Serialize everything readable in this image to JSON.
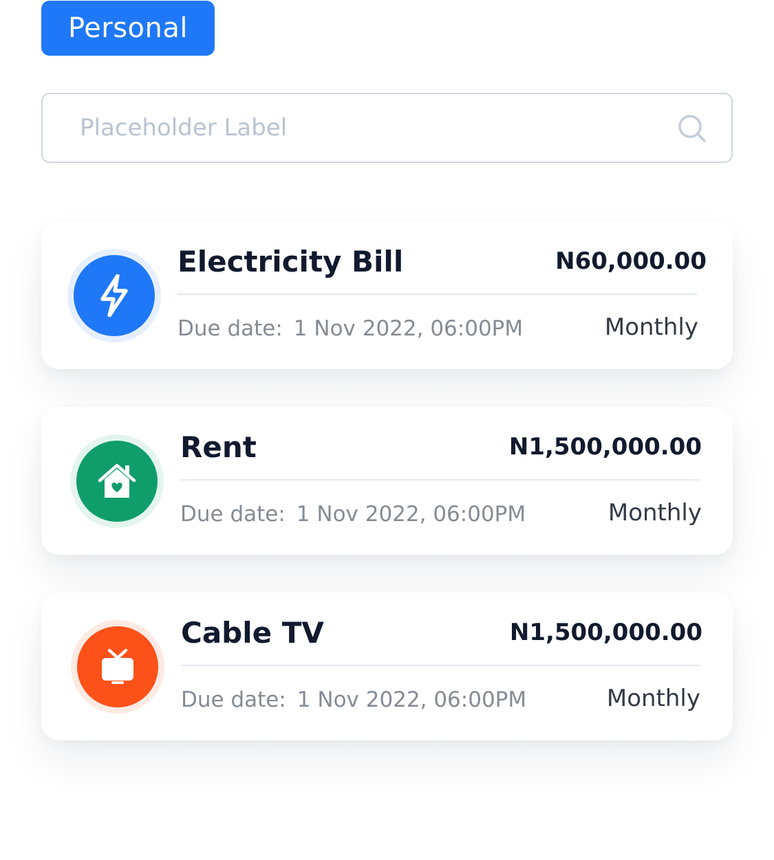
{
  "filter": {
    "active_tag": "Personal",
    "accent_color": "#1f78f7"
  },
  "search": {
    "value": "",
    "placeholder": "Placeholder Label",
    "icon": "search-icon"
  },
  "bills": [
    {
      "name": "Electricity Bill",
      "amount": "N60,000.00",
      "due_label": "Due date:",
      "due_value": "1 Nov 2022, 06:00PM",
      "frequency": "Monthly",
      "icon": "lightning-bolt-icon",
      "icon_color": "#1f78f7",
      "icon_ring_color": "#e6efff"
    },
    {
      "name": "Rent",
      "amount": "N1,500,000.00",
      "due_label": "Due date:",
      "due_value": "1 Nov 2022, 06:00PM",
      "frequency": "Monthly",
      "icon": "house-heart-icon",
      "icon_color": "#0f9d6b",
      "icon_ring_color": "#e3f5ee"
    },
    {
      "name": "Cable TV",
      "amount": "N1,500,000.00",
      "due_label": "Due date:",
      "due_value": "1 Nov 2022, 06:00PM",
      "frequency": "Monthly",
      "icon": "tv-icon",
      "icon_color": "#fc5118",
      "icon_ring_color": "#fdeae3"
    }
  ]
}
